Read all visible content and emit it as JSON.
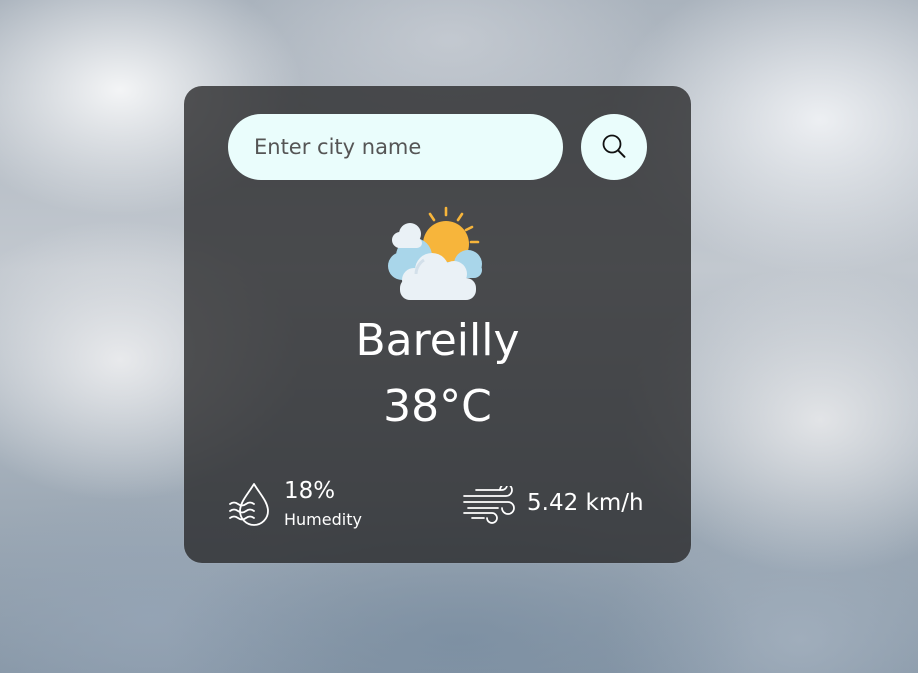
{
  "search": {
    "placeholder": "Enter city name",
    "value": ""
  },
  "weather": {
    "condition_icon": "partly-cloudy-sun-icon",
    "city": "Bareilly",
    "temperature": "38°C"
  },
  "details": {
    "humidity_icon": "humidity-drop-icon",
    "humidity_value": "18%",
    "humidity_label": "Humedity",
    "wind_icon": "wind-icon",
    "wind_value": "5.42 km/h"
  },
  "colors": {
    "card_background": "#262628",
    "input_background": "#eafdfc",
    "sun": "#f7b53b",
    "cloud_front": "#eaf1f6",
    "cloud_back": "#a9d6ea"
  }
}
